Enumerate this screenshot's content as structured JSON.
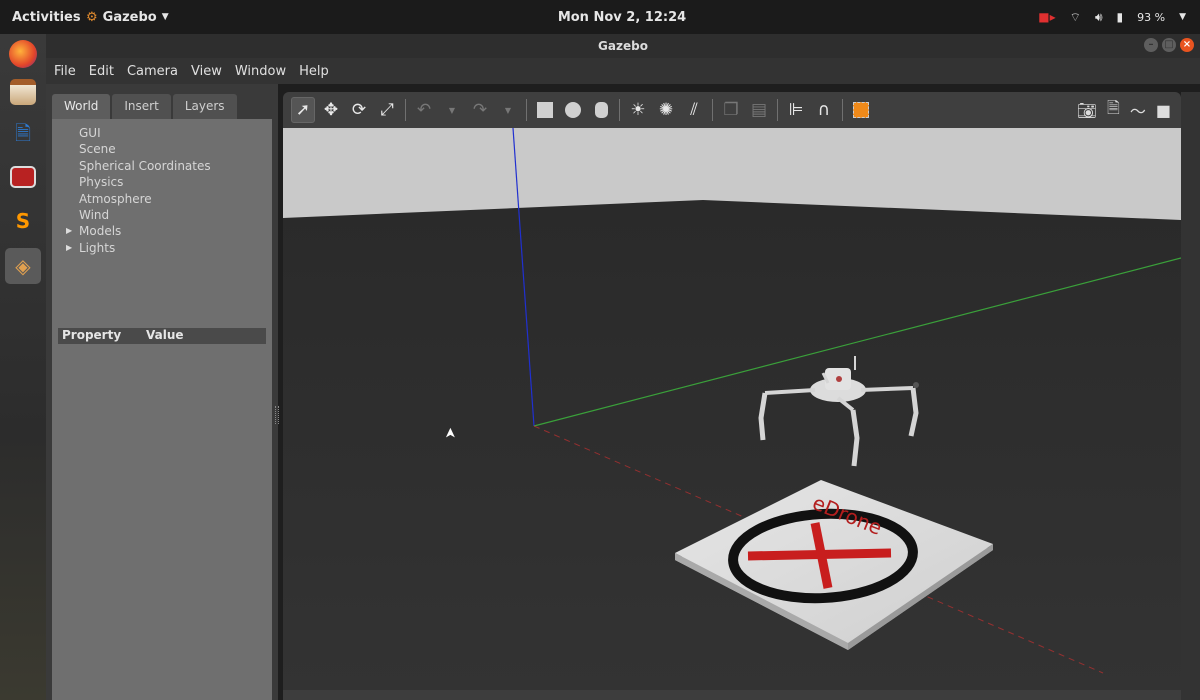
{
  "topbar": {
    "activities": "Activities",
    "app_name": "Gazebo",
    "clock": "Mon Nov  2, 12:24",
    "battery": "93 %"
  },
  "window": {
    "title": "Gazebo"
  },
  "menubar": {
    "items": [
      "File",
      "Edit",
      "Camera",
      "View",
      "Window",
      "Help"
    ]
  },
  "left_panel": {
    "tabs": [
      "World",
      "Insert",
      "Layers"
    ],
    "active_tab": "World",
    "tree": [
      {
        "label": "GUI",
        "expandable": false
      },
      {
        "label": "Scene",
        "expandable": false
      },
      {
        "label": "Spherical Coordinates",
        "expandable": false
      },
      {
        "label": "Physics",
        "expandable": false
      },
      {
        "label": "Atmosphere",
        "expandable": false
      },
      {
        "label": "Wind",
        "expandable": false
      },
      {
        "label": "Models",
        "expandable": true
      },
      {
        "label": "Lights",
        "expandable": true
      }
    ],
    "property_header": {
      "property": "Property",
      "value": "Value"
    }
  },
  "scene": {
    "pad_logo": "eDrone",
    "axis_colors": {
      "x": "#d03030",
      "y": "#3aa03a",
      "z": "#2030d0"
    }
  }
}
